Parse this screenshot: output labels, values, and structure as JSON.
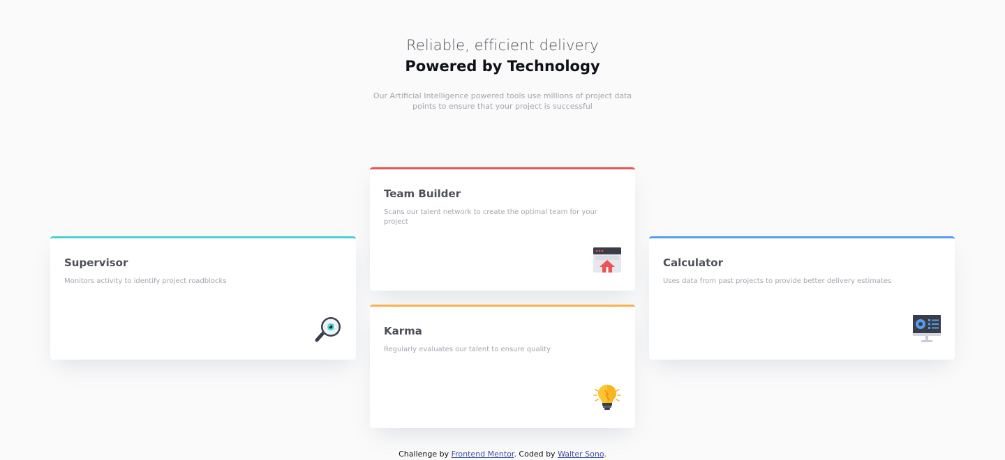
{
  "header": {
    "subtitle": "Reliable, efficient delivery",
    "title": "Powered by Technology",
    "intro": "Our Artificial Intelligence powered tools use millions of project data points to ensure that your project is successful"
  },
  "cards": {
    "supervisor": {
      "title": "Supervisor",
      "description": "Monitors activity to identify project roadblocks",
      "icon": "magnifying-glass-eye-icon",
      "accent": "#44d3d2"
    },
    "team_builder": {
      "title": "Team Builder",
      "description": "Scans our talent network to create the optimal team for your project",
      "icon": "browser-window-upload-icon",
      "accent": "#ea5454"
    },
    "karma": {
      "title": "Karma",
      "description": "Regularly evaluates our talent to ensure quality",
      "icon": "lightbulb-icon",
      "accent": "#fcaf4a"
    },
    "calculator": {
      "title": "Calculator",
      "description": "Uses data from past projects to provide better delivery estimates",
      "icon": "monitor-dashboard-icon",
      "accent": "#549ef2"
    }
  },
  "footer": {
    "prefix": "Challenge by ",
    "challenge_link": "Frontend Mentor",
    "middle": ". Coded by ",
    "author_link": "Walter Sono",
    "suffix": "."
  }
}
